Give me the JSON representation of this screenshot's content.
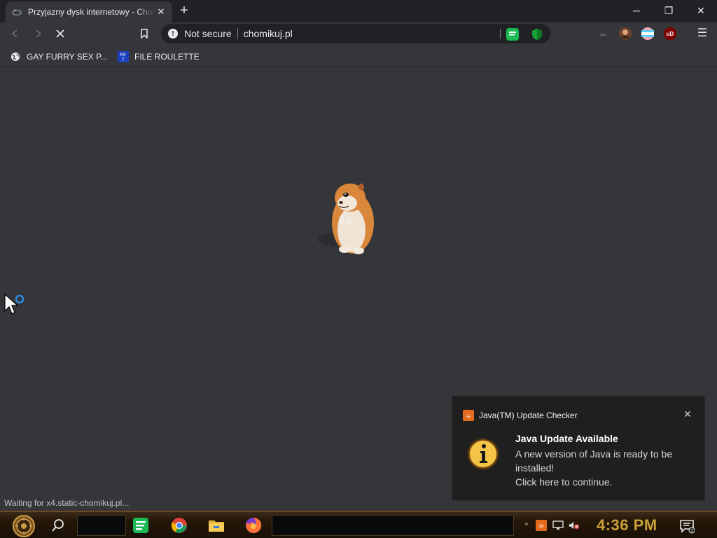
{
  "browser": {
    "tab": {
      "title": "Przyjazny dysk internetowy - Chomikuj.pl",
      "favicon": "hamster-favicon"
    },
    "window_controls": {
      "minimize": "─",
      "restore": "❐",
      "close": "✕"
    },
    "omnibox": {
      "security_label": "Not secure",
      "url": "chomikuj.pl"
    },
    "bookmarks": [
      {
        "label": "GAY FURRY SEX P...",
        "icon": "globe-icon"
      },
      {
        "label": "FILE ROULETTE",
        "icon": "mf-icon",
        "icon_text": "MF\nT"
      }
    ],
    "status_text": "Waiting for x4.static-chomikuj.pl..."
  },
  "page": {
    "image": "hamster-image",
    "background": "#35363a"
  },
  "toast": {
    "app_name": "Java(TM) Update Checker",
    "heading": "Java Update Available",
    "body_line1": "A new version of Java is ready to be installed!",
    "body_line2": "Click here to continue.",
    "close": "✕"
  },
  "taskbar": {
    "clock": "4:36 PM",
    "apps": [
      "spotify-icon",
      "chrome-icon",
      "file-explorer-icon",
      "firefox-icon"
    ]
  },
  "colors": {
    "chrome_dark": "#202124",
    "chrome_mid": "#35363a",
    "clock_gold": "#c9a13a",
    "java_orange": "#e46b1e"
  }
}
